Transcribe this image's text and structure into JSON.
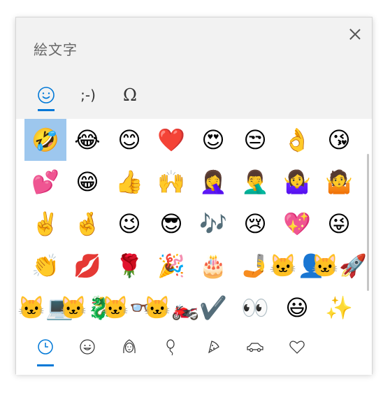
{
  "window": {
    "title": "絵文字"
  },
  "tabs": [
    {
      "label": "☺",
      "name": "emoji",
      "active": true
    },
    {
      "label": ";-)",
      "name": "kaomoji",
      "active": false
    },
    {
      "label": "Ω",
      "name": "symbols",
      "active": false
    }
  ],
  "emoji_grid": [
    [
      "🤣",
      "😂",
      "😊",
      "❤️",
      "😍",
      "😒",
      "👌",
      "😘"
    ],
    [
      "💕",
      "😁",
      "👍",
      "🙌",
      "🤦‍♀️",
      "🤦‍♂️",
      "🤷‍♀️",
      "🤷"
    ],
    [
      "✌️",
      "🤞",
      "😉",
      "😎",
      "🎶",
      "😢",
      "💖",
      "😜"
    ],
    [
      "👏",
      "💋",
      "🌹",
      "🎉",
      "🎂",
      "🤳",
      "🐱‍👤",
      "🐱‍🚀"
    ],
    [
      "🐱‍💻",
      "🐱‍🐉",
      "🐱‍👓",
      "🐱‍🏍",
      "✔️",
      "👀",
      "😃",
      "✨"
    ]
  ],
  "selected": {
    "row": 0,
    "col": 0
  },
  "bottom_tabs": [
    {
      "name": "recent",
      "icon": "clock-icon",
      "active": true
    },
    {
      "name": "smileys",
      "icon": "smiley-icon",
      "active": false
    },
    {
      "name": "people",
      "icon": "person-icon",
      "active": false
    },
    {
      "name": "celebration",
      "icon": "balloon-icon",
      "active": false
    },
    {
      "name": "food",
      "icon": "pizza-icon",
      "active": false
    },
    {
      "name": "travel",
      "icon": "car-icon",
      "active": false
    },
    {
      "name": "symbols",
      "icon": "heart-icon",
      "active": false
    }
  ],
  "colors": {
    "accent": "#0078d7",
    "selected_bg": "#9dc7ee",
    "panel_bg": "#f2f2f2"
  }
}
